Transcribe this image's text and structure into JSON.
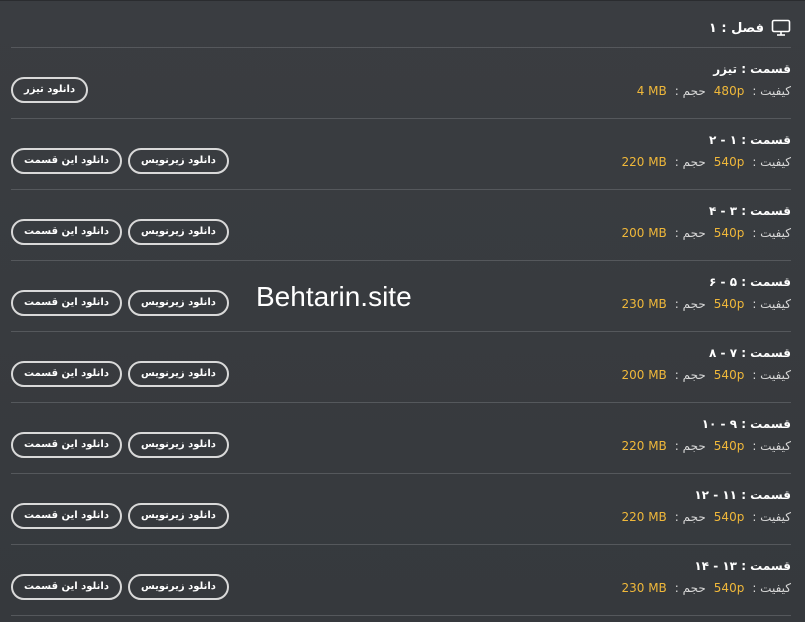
{
  "season": {
    "title": "فصل : ۱",
    "icon": "monitor-icon"
  },
  "labels": {
    "quality": "کیفیت :",
    "size": "حجم :"
  },
  "episodes": [
    {
      "title": "قسمت : تیزر",
      "quality": "480p",
      "size": "4 MB",
      "buttons": [
        "دانلود تیزر"
      ]
    },
    {
      "title": "قسمت : ۱ - ۲",
      "quality": "540p",
      "size": "220 MB",
      "buttons": [
        "دانلود زیرنویس",
        "دانلود این قسمت"
      ]
    },
    {
      "title": "قسمت : ۳ - ۴",
      "quality": "540p",
      "size": "200 MB",
      "buttons": [
        "دانلود زیرنویس",
        "دانلود این قسمت"
      ]
    },
    {
      "title": "قسمت : ۵ - ۶",
      "quality": "540p",
      "size": "230 MB",
      "buttons": [
        "دانلود زیرنویس",
        "دانلود این قسمت"
      ]
    },
    {
      "title": "قسمت : ۷ - ۸",
      "quality": "540p",
      "size": "200 MB",
      "buttons": [
        "دانلود زیرنویس",
        "دانلود این قسمت"
      ]
    },
    {
      "title": "قسمت : ۹ - ۱۰",
      "quality": "540p",
      "size": "220 MB",
      "buttons": [
        "دانلود زیرنویس",
        "دانلود این قسمت"
      ]
    },
    {
      "title": "قسمت : ۱۱ - ۱۲",
      "quality": "540p",
      "size": "220 MB",
      "buttons": [
        "دانلود زیرنویس",
        "دانلود این قسمت"
      ]
    },
    {
      "title": "قسمت : ۱۳ - ۱۴",
      "quality": "540p",
      "size": "230 MB",
      "buttons": [
        "دانلود زیرنویس",
        "دانلود این قسمت"
      ]
    }
  ],
  "watermark": "Behtarin.site",
  "colors": {
    "background": "#383b3f",
    "accent": "#f0b83a",
    "text": "#ffffff",
    "separator": "#55585c"
  }
}
